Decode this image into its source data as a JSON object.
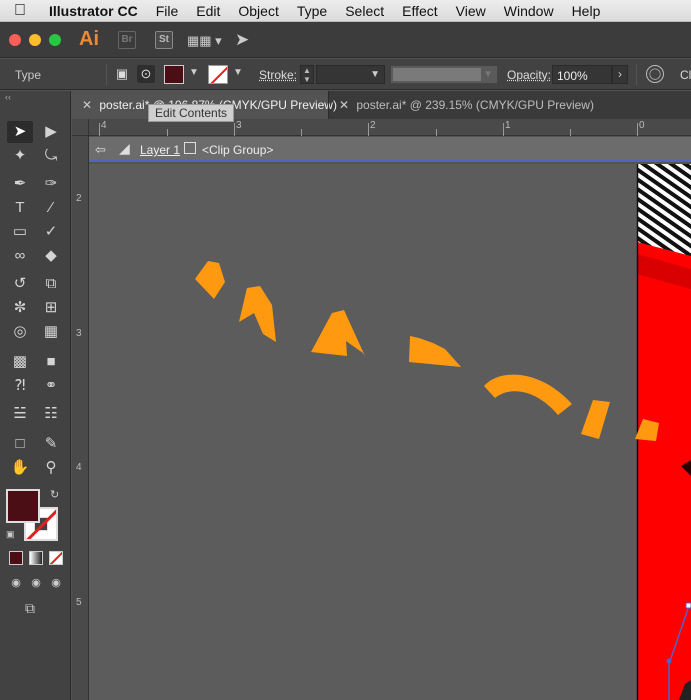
{
  "menubar": {
    "app_name": "Illustrator CC",
    "items": [
      "File",
      "Edit",
      "Object",
      "Type",
      "Select",
      "Effect",
      "View",
      "Window",
      "Help"
    ]
  },
  "appbar": {
    "logo": "Ai",
    "bridge": "Br",
    "stock": "St"
  },
  "control": {
    "selection_type": "Type",
    "fill_color": "#4a0e14",
    "stroke_label": "Stroke:",
    "opacity_label": "Opacity:",
    "opacity_value": "100%",
    "cut_label": "Cl"
  },
  "tabs": [
    {
      "label": "poster.ai* @ 106.87% (CMYK/GPU Preview)",
      "active": true
    },
    {
      "label": "poster.ai* @ 239.15% (CMYK/GPU Preview)",
      "active": false
    }
  ],
  "tooltip": "Edit Contents",
  "ruler": {
    "top_labels": [
      "4",
      "3",
      "2",
      "1",
      "0"
    ],
    "left_labels": [
      "2",
      "3",
      "4",
      "5"
    ]
  },
  "isolation": {
    "layer": "Layer 1",
    "group": "<Clip Group>"
  },
  "colors": {
    "artboard_red": "#ff0000",
    "text_orange": "#ff9a10",
    "fill": "#4a0e14",
    "selection_blue": "#5560c8"
  }
}
